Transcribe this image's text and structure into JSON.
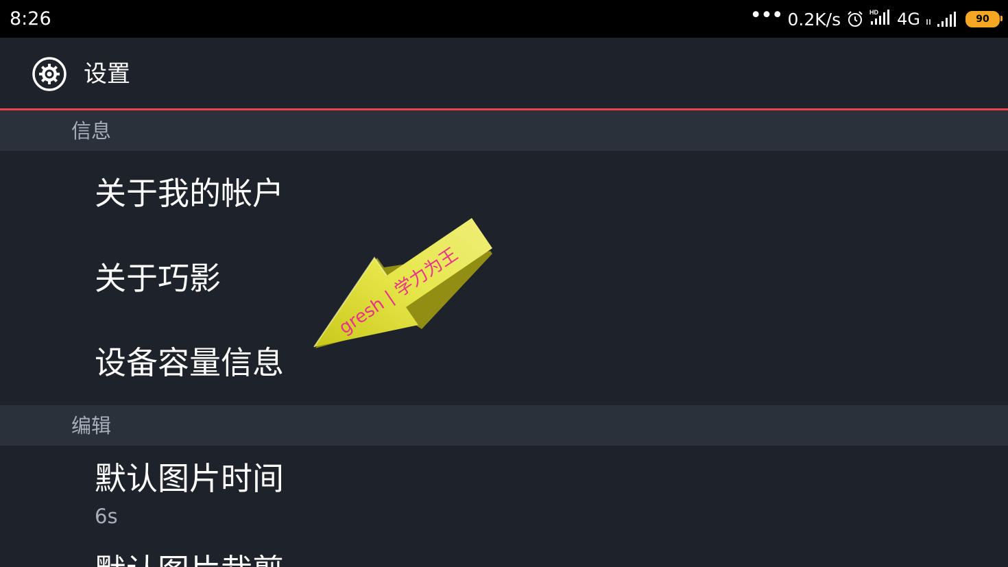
{
  "status_bar": {
    "time": "8:26",
    "more": "•••",
    "net_speed": "0.2K/s",
    "hd_label": "HD",
    "network": "4G",
    "battery": "90",
    "battery_color": "#f5a623"
  },
  "action_bar": {
    "title": "设置",
    "icon": "settings-gear-icon"
  },
  "accent_color": "#e8464d",
  "sections": {
    "info": {
      "header": "信息",
      "items": {
        "account": "关于我的帐户",
        "about": "关于巧影",
        "storage": "设备容量信息"
      }
    },
    "edit": {
      "header": "编辑",
      "items": {
        "image_duration": {
          "title": "默认图片时间",
          "summary": "6s"
        },
        "image_crop": {
          "title": "默认图片裁剪"
        }
      }
    }
  },
  "watermark": {
    "text": "gresh | 学力为王",
    "icon": "arrow-pointer-icon"
  }
}
